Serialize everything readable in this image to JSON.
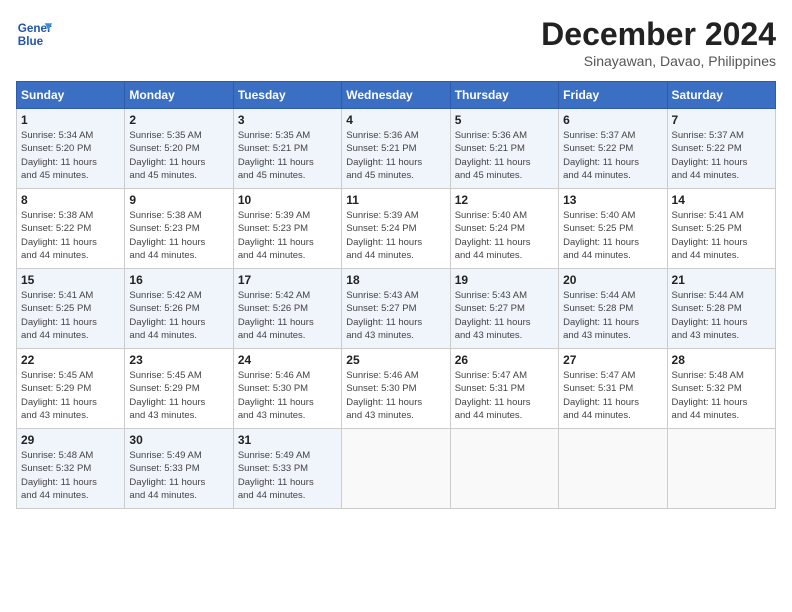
{
  "header": {
    "logo_line1": "General",
    "logo_line2": "Blue",
    "month_year": "December 2024",
    "location": "Sinayawan, Davao, Philippines"
  },
  "days_of_week": [
    "Sunday",
    "Monday",
    "Tuesday",
    "Wednesday",
    "Thursday",
    "Friday",
    "Saturday"
  ],
  "weeks": [
    [
      {
        "day": "1",
        "info": "Sunrise: 5:34 AM\nSunset: 5:20 PM\nDaylight: 11 hours\nand 45 minutes."
      },
      {
        "day": "2",
        "info": "Sunrise: 5:35 AM\nSunset: 5:20 PM\nDaylight: 11 hours\nand 45 minutes."
      },
      {
        "day": "3",
        "info": "Sunrise: 5:35 AM\nSunset: 5:21 PM\nDaylight: 11 hours\nand 45 minutes."
      },
      {
        "day": "4",
        "info": "Sunrise: 5:36 AM\nSunset: 5:21 PM\nDaylight: 11 hours\nand 45 minutes."
      },
      {
        "day": "5",
        "info": "Sunrise: 5:36 AM\nSunset: 5:21 PM\nDaylight: 11 hours\nand 45 minutes."
      },
      {
        "day": "6",
        "info": "Sunrise: 5:37 AM\nSunset: 5:22 PM\nDaylight: 11 hours\nand 44 minutes."
      },
      {
        "day": "7",
        "info": "Sunrise: 5:37 AM\nSunset: 5:22 PM\nDaylight: 11 hours\nand 44 minutes."
      }
    ],
    [
      {
        "day": "8",
        "info": "Sunrise: 5:38 AM\nSunset: 5:22 PM\nDaylight: 11 hours\nand 44 minutes."
      },
      {
        "day": "9",
        "info": "Sunrise: 5:38 AM\nSunset: 5:23 PM\nDaylight: 11 hours\nand 44 minutes."
      },
      {
        "day": "10",
        "info": "Sunrise: 5:39 AM\nSunset: 5:23 PM\nDaylight: 11 hours\nand 44 minutes."
      },
      {
        "day": "11",
        "info": "Sunrise: 5:39 AM\nSunset: 5:24 PM\nDaylight: 11 hours\nand 44 minutes."
      },
      {
        "day": "12",
        "info": "Sunrise: 5:40 AM\nSunset: 5:24 PM\nDaylight: 11 hours\nand 44 minutes."
      },
      {
        "day": "13",
        "info": "Sunrise: 5:40 AM\nSunset: 5:25 PM\nDaylight: 11 hours\nand 44 minutes."
      },
      {
        "day": "14",
        "info": "Sunrise: 5:41 AM\nSunset: 5:25 PM\nDaylight: 11 hours\nand 44 minutes."
      }
    ],
    [
      {
        "day": "15",
        "info": "Sunrise: 5:41 AM\nSunset: 5:25 PM\nDaylight: 11 hours\nand 44 minutes."
      },
      {
        "day": "16",
        "info": "Sunrise: 5:42 AM\nSunset: 5:26 PM\nDaylight: 11 hours\nand 44 minutes."
      },
      {
        "day": "17",
        "info": "Sunrise: 5:42 AM\nSunset: 5:26 PM\nDaylight: 11 hours\nand 44 minutes."
      },
      {
        "day": "18",
        "info": "Sunrise: 5:43 AM\nSunset: 5:27 PM\nDaylight: 11 hours\nand 43 minutes."
      },
      {
        "day": "19",
        "info": "Sunrise: 5:43 AM\nSunset: 5:27 PM\nDaylight: 11 hours\nand 43 minutes."
      },
      {
        "day": "20",
        "info": "Sunrise: 5:44 AM\nSunset: 5:28 PM\nDaylight: 11 hours\nand 43 minutes."
      },
      {
        "day": "21",
        "info": "Sunrise: 5:44 AM\nSunset: 5:28 PM\nDaylight: 11 hours\nand 43 minutes."
      }
    ],
    [
      {
        "day": "22",
        "info": "Sunrise: 5:45 AM\nSunset: 5:29 PM\nDaylight: 11 hours\nand 43 minutes."
      },
      {
        "day": "23",
        "info": "Sunrise: 5:45 AM\nSunset: 5:29 PM\nDaylight: 11 hours\nand 43 minutes."
      },
      {
        "day": "24",
        "info": "Sunrise: 5:46 AM\nSunset: 5:30 PM\nDaylight: 11 hours\nand 43 minutes."
      },
      {
        "day": "25",
        "info": "Sunrise: 5:46 AM\nSunset: 5:30 PM\nDaylight: 11 hours\nand 43 minutes."
      },
      {
        "day": "26",
        "info": "Sunrise: 5:47 AM\nSunset: 5:31 PM\nDaylight: 11 hours\nand 44 minutes."
      },
      {
        "day": "27",
        "info": "Sunrise: 5:47 AM\nSunset: 5:31 PM\nDaylight: 11 hours\nand 44 minutes."
      },
      {
        "day": "28",
        "info": "Sunrise: 5:48 AM\nSunset: 5:32 PM\nDaylight: 11 hours\nand 44 minutes."
      }
    ],
    [
      {
        "day": "29",
        "info": "Sunrise: 5:48 AM\nSunset: 5:32 PM\nDaylight: 11 hours\nand 44 minutes."
      },
      {
        "day": "30",
        "info": "Sunrise: 5:49 AM\nSunset: 5:33 PM\nDaylight: 11 hours\nand 44 minutes."
      },
      {
        "day": "31",
        "info": "Sunrise: 5:49 AM\nSunset: 5:33 PM\nDaylight: 11 hours\nand 44 minutes."
      },
      {
        "day": "",
        "info": ""
      },
      {
        "day": "",
        "info": ""
      },
      {
        "day": "",
        "info": ""
      },
      {
        "day": "",
        "info": ""
      }
    ]
  ]
}
